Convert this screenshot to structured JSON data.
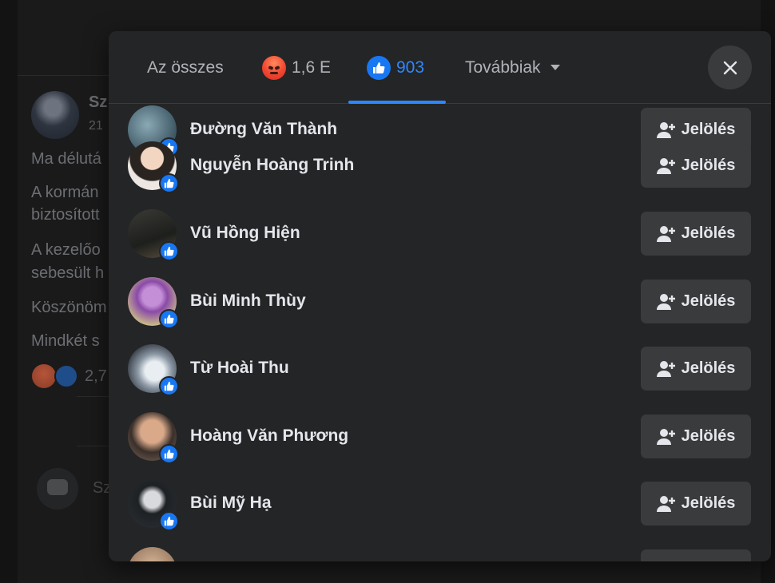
{
  "background_post": {
    "author": "Sz",
    "date": "21",
    "lines": [
      "Ma délutá",
      "A kormán",
      "biztosított",
      "A kezelőo",
      "sebesült h",
      "Köszönöm",
      "Mindkét s"
    ],
    "reaction_count": "2,7",
    "comment_placeholder": "Sz"
  },
  "modal": {
    "tabs": {
      "all_label": "Az összes",
      "angry_count": "1,6 E",
      "like_count": "903",
      "more_label": "Továbbiak"
    },
    "colors": {
      "accent": "#2d88ff",
      "surface": "#242526",
      "button": "#3a3b3c"
    },
    "rows": [
      {
        "name": "Đường Văn Thành",
        "button": "Jelölés"
      },
      {
        "name": "Nguyễn Hoàng Trinh",
        "button": "Jelölés"
      },
      {
        "name": "Vũ Hồng Hiện",
        "button": "Jelölés"
      },
      {
        "name": "Bùi Minh Thùy",
        "button": "Jelölés"
      },
      {
        "name": "Từ Hoài Thu",
        "button": "Jelölés"
      },
      {
        "name": "Hoàng Văn Phương",
        "button": "Jelölés"
      },
      {
        "name": "Bùi Mỹ Hạ",
        "button": "Jelölés"
      },
      {
        "name": "",
        "button": ""
      }
    ]
  }
}
